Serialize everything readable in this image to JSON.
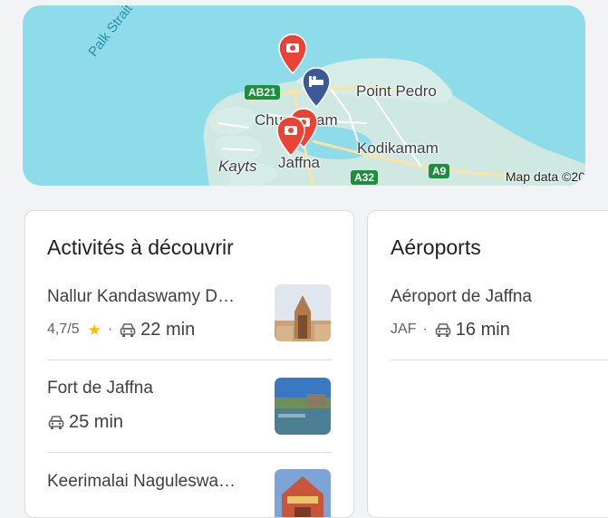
{
  "map": {
    "strait_label": "Palk Strait",
    "places": {
      "point_pedro": "Point Pedro",
      "chunnakam": "Chunnakam",
      "kodikamam": "Kodikamam",
      "kayts": "Kayts",
      "jaffna": "Jaffna"
    },
    "roads": {
      "ab21": "AB21",
      "a32": "A32",
      "a9": "A9"
    },
    "attribution": "Map data ©20",
    "pins": [
      {
        "kind": "camera",
        "color": "#ea4335"
      },
      {
        "kind": "hotel",
        "color": "#3b5998"
      },
      {
        "kind": "camera",
        "color": "#ea4335"
      },
      {
        "kind": "camera",
        "color": "#ea4335"
      }
    ]
  },
  "activities": {
    "title": "Activités à découvrir",
    "items": [
      {
        "name": "Nallur Kandaswamy D…",
        "rating": "4,7/5",
        "drive_time": "22 min"
      },
      {
        "name": "Fort de Jaffna",
        "drive_time": "25 min"
      },
      {
        "name": "Keerimalai Naguleswa…"
      }
    ]
  },
  "airports": {
    "title": "Aéroports",
    "items": [
      {
        "name": "Aéroport de Jaffna",
        "code": "JAF",
        "drive_time": "16 min"
      }
    ]
  },
  "colors": {
    "map_water": "#8edcea",
    "pin_red": "#ea4335",
    "pin_blue": "#3b5998",
    "road_green": "#1e8e3e",
    "star": "#fbbc04"
  }
}
